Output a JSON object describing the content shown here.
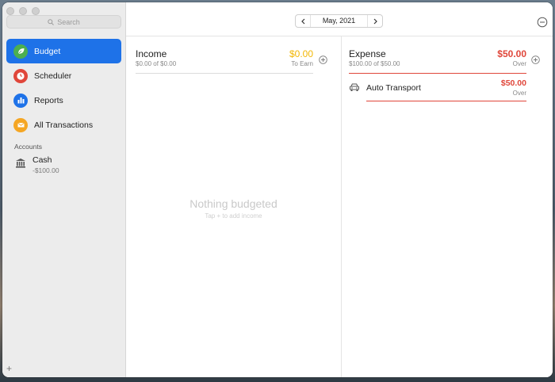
{
  "colors": {
    "accent": "#1e72e8",
    "income_amount": "#f2b705",
    "expense_red": "#e0463a"
  },
  "sidebar": {
    "search_placeholder": "Search",
    "items": [
      {
        "label": "Budget",
        "icon": "leaf-icon",
        "active": true
      },
      {
        "label": "Scheduler",
        "icon": "clock-icon",
        "active": false
      },
      {
        "label": "Reports",
        "icon": "bar-chart-icon",
        "active": false
      },
      {
        "label": "All Transactions",
        "icon": "envelope-icon",
        "active": false
      }
    ],
    "accounts_label": "Accounts",
    "account": {
      "name": "Cash",
      "balance": "-$100.00",
      "icon": "bank-icon"
    },
    "add_label": "+"
  },
  "toolbar": {
    "month": "May, 2021"
  },
  "income": {
    "title": "Income",
    "subtitle": "$0.00 of $0.00",
    "amount": "$0.00",
    "status": "To Earn",
    "empty_title": "Nothing budgeted",
    "empty_subtitle": "Tap + to add income"
  },
  "expense": {
    "title": "Expense",
    "subtitle": "$100.00 of $50.00",
    "amount": "$50.00",
    "status": "Over",
    "rows": [
      {
        "name": "Auto Transport",
        "amount": "$50.00",
        "status": "Over",
        "icon": "car-icon"
      }
    ]
  }
}
